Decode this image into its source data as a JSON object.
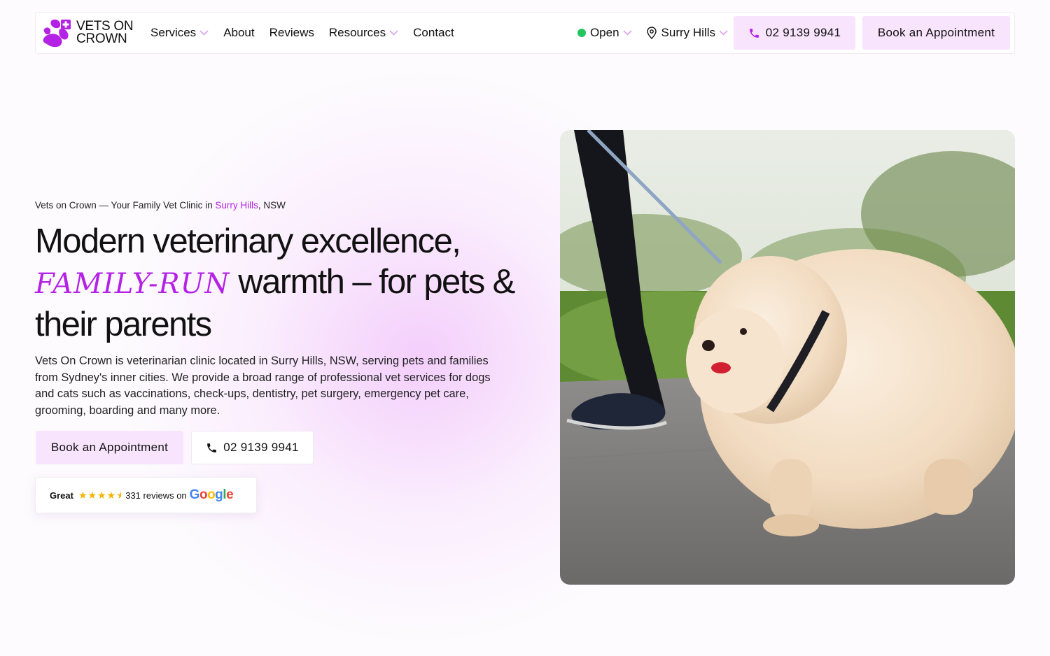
{
  "brand": {
    "name": "VETS ON\nCROWN",
    "accent": "#b422e6",
    "soft_button": "#f8e4fc"
  },
  "nav": {
    "items": [
      {
        "label": "Services",
        "dropdown": true
      },
      {
        "label": "About",
        "dropdown": false
      },
      {
        "label": "Reviews",
        "dropdown": false
      },
      {
        "label": "Resources",
        "dropdown": true
      },
      {
        "label": "Contact",
        "dropdown": false
      }
    ],
    "status": "Open",
    "location": "Surry Hills",
    "phone": "02 9139 9941",
    "book": "Book an Appointment"
  },
  "hero": {
    "eyebrow_pre": "Vets on Crown — Your Family Vet Clinic in ",
    "eyebrow_hl": "Surry Hills",
    "eyebrow_post": ", NSW",
    "headline_1": "Modern veterinary excellence,",
    "headline_script": "family-run",
    "headline_2": " warmth – for pets & their parents",
    "description": "Vets On Crown is veterinarian clinic located in Surry Hills, NSW, serving pets and families from Sydney's inner cities. We provide a broad range of professional vet services for dogs and cats such as vaccinations, check-ups, dentistry, pet surgery, emergency pet care, grooming, boarding and many more.",
    "book": "Book an Appointment",
    "phone": "02 9139 9941"
  },
  "reviews": {
    "rating_label": "Great",
    "stars": 4.5,
    "count_text": "331 reviews on",
    "source": "Google"
  }
}
